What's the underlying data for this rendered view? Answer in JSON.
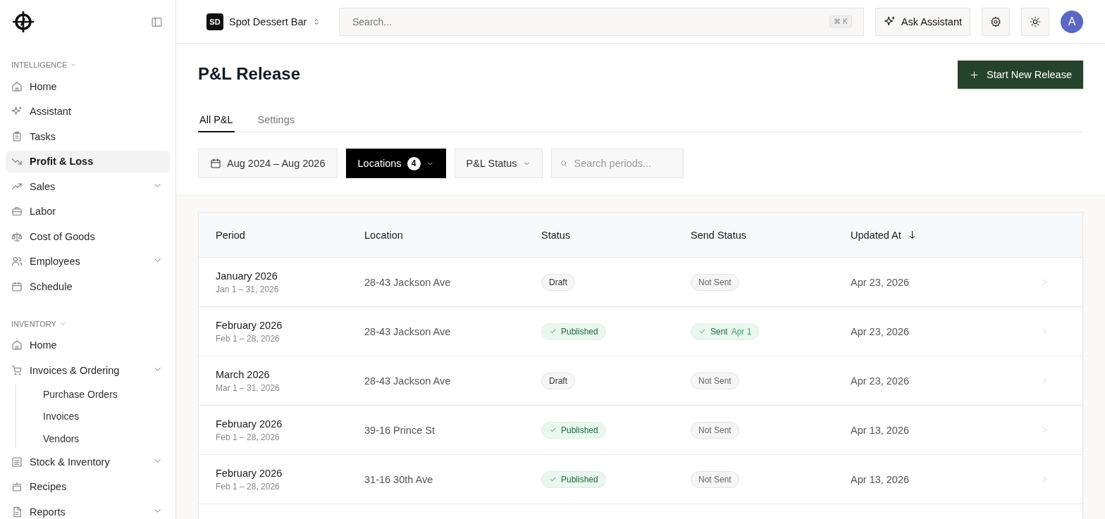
{
  "sidebar": {
    "sections": [
      {
        "label": "INTELLIGENCE",
        "items": [
          {
            "label": "Home",
            "selected": false,
            "has_submenu": false
          },
          {
            "label": "Assistant",
            "selected": false,
            "has_submenu": false
          },
          {
            "label": "Tasks",
            "selected": false,
            "has_submenu": false
          },
          {
            "label": "Profit & Loss",
            "selected": true,
            "has_submenu": false
          },
          {
            "label": "Sales",
            "selected": false,
            "has_submenu": true
          },
          {
            "label": "Labor",
            "selected": false,
            "has_submenu": false
          },
          {
            "label": "Cost of Goods",
            "selected": false,
            "has_submenu": false
          },
          {
            "label": "Employees",
            "selected": false,
            "has_submenu": true
          },
          {
            "label": "Schedule",
            "selected": false,
            "has_submenu": false
          }
        ]
      },
      {
        "label": "INVENTORY",
        "items": [
          {
            "label": "Home",
            "selected": false,
            "has_submenu": false
          },
          {
            "label": "Invoices & Ordering",
            "selected": false,
            "has_submenu": true,
            "children": [
              {
                "label": "Purchase Orders",
                "selected": false
              },
              {
                "label": "Invoices",
                "selected": false
              },
              {
                "label": "Vendors",
                "selected": false
              }
            ]
          },
          {
            "label": "Stock & Inventory",
            "selected": false,
            "has_submenu": true
          },
          {
            "label": "Recipes",
            "selected": false,
            "has_submenu": false
          },
          {
            "label": "Reports",
            "selected": false,
            "has_submenu": true
          }
        ]
      }
    ]
  },
  "topbar": {
    "org": {
      "initials": "SD",
      "name": "Spot Dessert Bar"
    },
    "search": {
      "placeholder": "Search...",
      "shortcut": "⌘ K"
    },
    "assistant_button": "Ask Assistant",
    "avatar": "A"
  },
  "page": {
    "title": "P&L Release",
    "primary_button": "Start New Release",
    "tabs": [
      {
        "label": "All P&L",
        "selected": true
      },
      {
        "label": "Settings",
        "selected": false
      }
    ],
    "filters": {
      "date_range": "Aug 2024 – Aug 2026",
      "locations": {
        "label": "Locations",
        "count": "4",
        "active": true
      },
      "status": {
        "label": "P&L Status",
        "active": false
      },
      "search": {
        "placeholder": "Search periods..."
      }
    }
  },
  "table": {
    "columns": [
      {
        "label": "Period",
        "sorted": false
      },
      {
        "label": "Location",
        "sorted": false
      },
      {
        "label": "Status",
        "sorted": false
      },
      {
        "label": "Send Status",
        "sorted": false
      },
      {
        "label": "Updated At",
        "sorted": true
      }
    ],
    "rows": [
      {
        "period": "January 2026",
        "range": "Jan 1 – 31, 2026",
        "location": "28-43 Jackson Ave",
        "status": {
          "label": "Draft",
          "kind": "draft"
        },
        "send_status": {
          "label": "Not Sent",
          "kind": "not_sent"
        },
        "updated": "Apr 23, 2026"
      },
      {
        "period": "February 2026",
        "range": "Feb 1 – 28, 2026",
        "location": "28-43 Jackson Ave",
        "status": {
          "label": "Published",
          "kind": "published"
        },
        "send_status": {
          "label": "Sent",
          "kind": "sent",
          "date": "Apr 1"
        },
        "updated": "Apr 23, 2026"
      },
      {
        "period": "March 2026",
        "range": "Mar 1 – 31, 2026",
        "location": "28-43 Jackson Ave",
        "status": {
          "label": "Draft",
          "kind": "draft"
        },
        "send_status": {
          "label": "Not Sent",
          "kind": "not_sent"
        },
        "updated": "Apr 23, 2026"
      },
      {
        "period": "February 2026",
        "range": "Feb 1 – 28, 2026",
        "location": "39-16 Prince St",
        "status": {
          "label": "Published",
          "kind": "published"
        },
        "send_status": {
          "label": "Not Sent",
          "kind": "not_sent"
        },
        "updated": "Apr 13, 2026"
      },
      {
        "period": "February 2026",
        "range": "Feb 1 – 28, 2026",
        "location": "31-16 30th Ave",
        "status": {
          "label": "Published",
          "kind": "published"
        },
        "send_status": {
          "label": "Not Sent",
          "kind": "not_sent"
        },
        "updated": "Apr 13, 2026"
      }
    ]
  }
}
